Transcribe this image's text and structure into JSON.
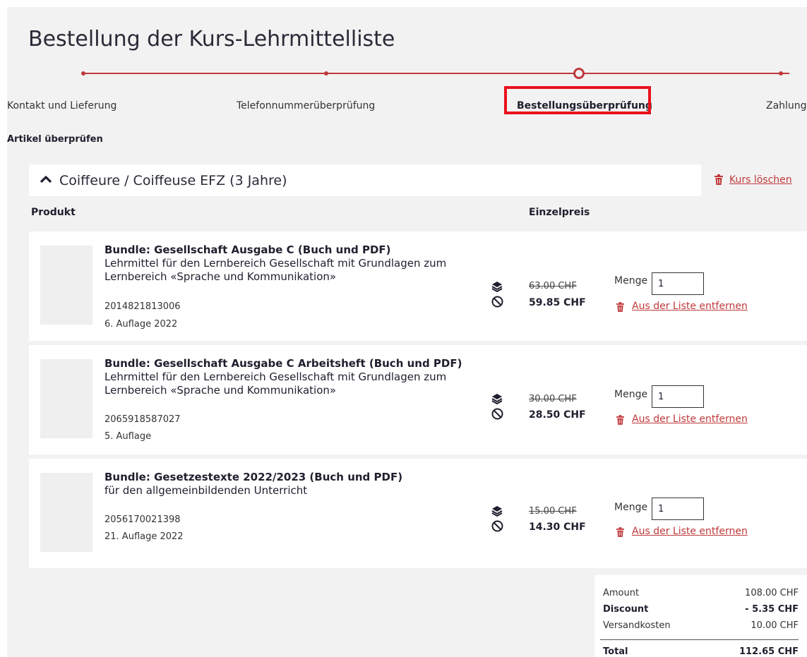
{
  "page": {
    "title": "Bestellung der Kurs-Lehrmittelliste"
  },
  "stepper": {
    "steps": [
      "Kontakt und Lieferung",
      "Telefonnummerüberprüfung",
      "Bestellungsüberprüfung",
      "Zahlung"
    ],
    "current_index": 2
  },
  "review": {
    "heading": "Artikel überprüfen"
  },
  "course": {
    "title": "Coiffeure / Coiffeuse EFZ (3 Jahre)",
    "delete_label": "Kurs löschen"
  },
  "columns": {
    "product": "Produkt",
    "unit_price": "Einzelpreis"
  },
  "labels": {
    "quantity": "Menge",
    "remove": "Aus der Liste entfernen"
  },
  "products": [
    {
      "name": "Bundle: Gesellschaft Ausgabe C (Buch und PDF)",
      "description": "Lehrmittel für den Lernbereich Gesellschaft mit Grundlagen zum Lernbereich «Sprache und Kommunikation»",
      "isbn": "2014821813006",
      "edition": "6. Auflage 2022",
      "old_price": "63.00 CHF",
      "price": "59.85 CHF",
      "quantity": "1"
    },
    {
      "name": "Bundle: Gesellschaft Ausgabe C Arbeitsheft (Buch und PDF)",
      "description": "Lehrmittel für den Lernbereich Gesellschaft mit Grundlagen zum Lernbereich «Sprache und Kommunikation»",
      "isbn": "2065918587027",
      "edition": "5. Auflage",
      "old_price": "30.00 CHF",
      "price": "28.50 CHF",
      "quantity": "1"
    },
    {
      "name": "Bundle: Gesetzestexte 2022/2023 (Buch und PDF)",
      "description": "für den allgemeinbildenden Unterricht",
      "isbn": "2056170021398",
      "edition": "21. Auflage 2022",
      "old_price": "15.00 CHF",
      "price": "14.30 CHF",
      "quantity": "1"
    }
  ],
  "totals": {
    "amount_label": "Amount",
    "amount": "108.00 CHF",
    "discount_label": "Discount",
    "discount": "- 5.35 CHF",
    "shipping_label": "Versandkosten",
    "shipping": "10.00 CHF",
    "total_label": "Total",
    "total": "112.65 CHF"
  },
  "colors": {
    "accent": "#c0393b",
    "highlight": "#e8121c",
    "background": "#f2f2f2"
  },
  "icons": [
    "chevron-up-icon",
    "trash-icon",
    "book-stack-icon",
    "no-entry-icon"
  ]
}
